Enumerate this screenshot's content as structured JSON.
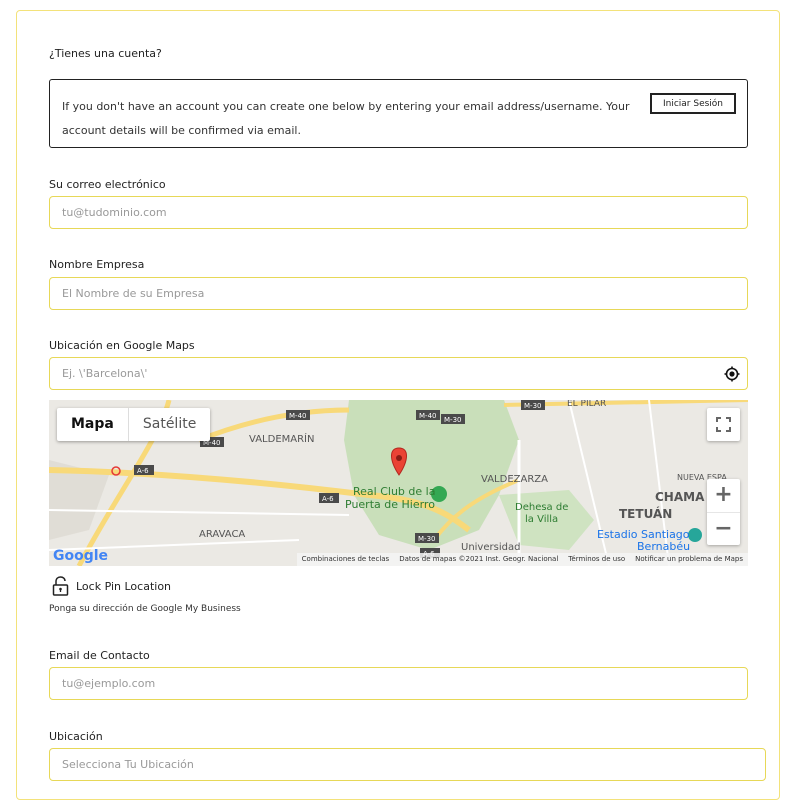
{
  "account": {
    "question": "¿Tienes una cuenta?",
    "info": "If you don't have an account you can create one below by entering your email address/username. Your account details will be confirmed via email.",
    "login_button": "Iniciar Sesión"
  },
  "fields": {
    "email": {
      "label": "Su correo electrónico",
      "placeholder": "tu@tudominio.com"
    },
    "company": {
      "label": "Nombre Empresa",
      "placeholder": "El Nombre de su Empresa"
    },
    "maps_location": {
      "label": "Ubicación en Google Maps",
      "placeholder": "Ej. \\'Barcelona\\'"
    },
    "contact_email": {
      "label": "Email de Contacto",
      "placeholder": "tu@ejemplo.com"
    },
    "location": {
      "label": "Ubicación",
      "placeholder": "Selecciona Tu Ubicación"
    }
  },
  "map": {
    "type_map": "Mapa",
    "type_satellite": "Satélite",
    "zoom_in": "+",
    "zoom_out": "−",
    "logo": "Google",
    "attribution": {
      "shortcuts": "Combinaciones de teclas",
      "data": "Datos de mapas ©2021 Inst. Geogr. Nacional",
      "terms": "Términos de uso",
      "report": "Notificar un problema de Maps"
    },
    "places": {
      "valdemarin": "VALDEMARÍN",
      "aravaca": "ARAVACA",
      "valdezarza": "VALDEZARZA",
      "tetuan": "TETUÁN",
      "chamartin": "CHAMA",
      "el_pilar": "EL PILAR",
      "nueva_espana": "NUEVA ESPA",
      "club_1": "Real Club de la",
      "club_2": "Puerta de Hierro",
      "dehesa_1": "Dehesa de",
      "dehesa_2": "la Villa",
      "estadio_1": "Estadio Santiago",
      "estadio_2": "Bernabéu",
      "universidad": "Universidad",
      "m40a": "M-40",
      "m40b": "M-40",
      "m40c": "M-40",
      "m30a": "M-30",
      "m30b": "M-30",
      "m30c": "M-30",
      "a6a": "A-6",
      "a6b": "A-6",
      "a6c": "A-6"
    }
  },
  "lock": {
    "label": "Lock Pin Location"
  },
  "help_text": "Ponga su dirección de Google My Business",
  "colors": {
    "field_border": "#e7d858",
    "card_border": "#f3e27a",
    "pin": "#ea4335"
  }
}
